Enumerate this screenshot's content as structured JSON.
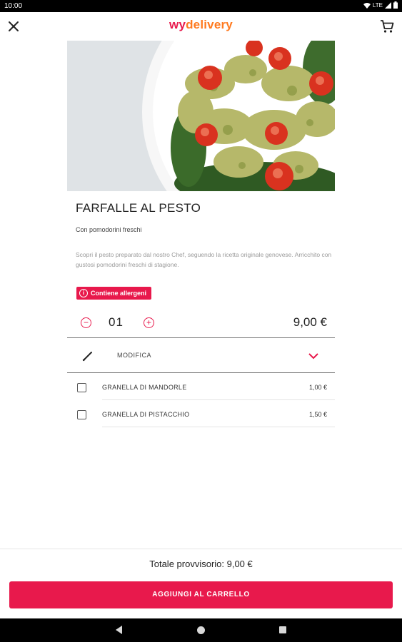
{
  "status_bar": {
    "time": "10:00",
    "network": "LTE"
  },
  "app_bar": {
    "logo_part1": "wy",
    "logo_part2": "delivery"
  },
  "product": {
    "image_alt": "Farfalle al pesto con pomodorini",
    "title": "FARFALLE AL PESTO",
    "subtitle": "Con pomodorini freschi",
    "description": "Scopri il pesto preparato dal nostro Chef, seguendo la ricetta originale genovese. Arricchito con gustosi pomodorini freschi di stagione.",
    "allergen_badge": "Contiene allergeni",
    "quantity": "01",
    "price": "9,00 €"
  },
  "modify": {
    "label": "MODIFICA"
  },
  "options": [
    {
      "name": "GRANELLA DI MANDORLE",
      "price": "1,00 €"
    },
    {
      "name": "GRANELLA DI PISTACCHIO",
      "price": "1,50 €"
    }
  ],
  "footer": {
    "total": "Totale provvisorio: 9,00 €",
    "add_button": "AGGIUNGI AL CARRELLO"
  },
  "colors": {
    "accent": "#e8194c",
    "logo_orange": "#ff7a1f"
  }
}
